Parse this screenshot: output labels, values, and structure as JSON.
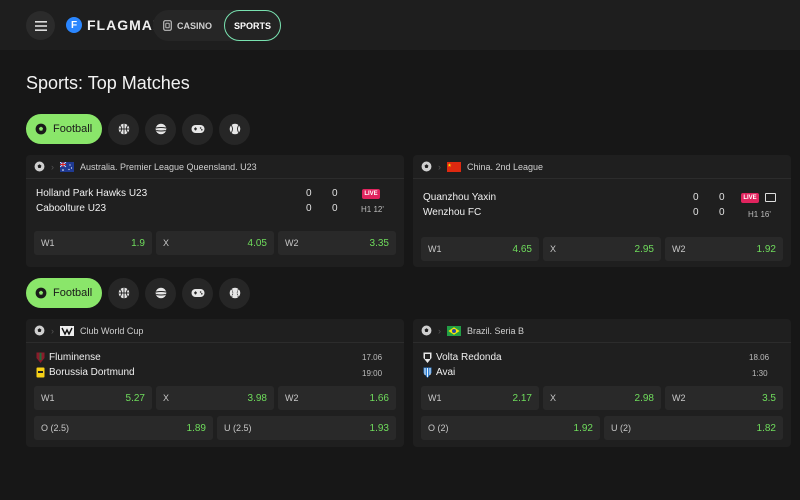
{
  "header": {
    "logo_text": "FLAGMAN",
    "logo_letter": "F",
    "nav": {
      "casino": "CASINO",
      "sports": "SPORTS"
    }
  },
  "page_title": "Sports: Top Matches",
  "filters": [
    {
      "label": "Football",
      "icons": [
        "basketball-icon",
        "volleyball-icon",
        "esports-gamepad-icon",
        "tennis-icon"
      ]
    },
    {
      "label": "Football",
      "icons": [
        "basketball-icon",
        "volleyball-icon",
        "esports-gamepad-icon",
        "baseball-icon"
      ]
    }
  ],
  "cards": [
    {
      "league": "Australia. Premier League Queensland. U23",
      "flag": "australia",
      "team1": "Holland Park Hawks U23",
      "team2": "Caboolture U23",
      "score1": [
        "0",
        "0"
      ],
      "score2": [
        "0",
        "0"
      ],
      "live": "LIVE",
      "time": "H1 12'",
      "odds": [
        {
          "label": "W1",
          "value": "1.9"
        },
        {
          "label": "X",
          "value": "4.05"
        },
        {
          "label": "W2",
          "value": "3.35"
        }
      ]
    },
    {
      "league": "China. 2nd League",
      "flag": "china",
      "team1": "Quanzhou Yaxin",
      "team2": "Wenzhou FC",
      "score1": [
        "0",
        "0"
      ],
      "score2": [
        "0",
        "0"
      ],
      "live": "LIVE",
      "time": "H1 16'",
      "odds": [
        {
          "label": "W1",
          "value": "4.65"
        },
        {
          "label": "X",
          "value": "2.95"
        },
        {
          "label": "W2",
          "value": "1.92"
        }
      ]
    },
    {
      "league": "Club World Cup",
      "flag": "cwc",
      "team1": "Fluminense",
      "team2": "Borussia Dortmund",
      "date": "17.06",
      "kickoff": "19:00",
      "odds": [
        {
          "label": "W1",
          "value": "5.27"
        },
        {
          "label": "X",
          "value": "3.98"
        },
        {
          "label": "W2",
          "value": "1.66"
        }
      ],
      "totals": [
        {
          "label": "O (2.5)",
          "value": "1.89"
        },
        {
          "label": "U (2.5)",
          "value": "1.93"
        }
      ]
    },
    {
      "league": "Brazil. Seria B",
      "flag": "brazil",
      "team1": "Volta Redonda",
      "team2": "Avai",
      "date": "18.06",
      "kickoff": "1:30",
      "odds": [
        {
          "label": "W1",
          "value": "2.17"
        },
        {
          "label": "X",
          "value": "2.98"
        },
        {
          "label": "W2",
          "value": "3.5"
        }
      ],
      "totals": [
        {
          "label": "O (2)",
          "value": "1.92"
        },
        {
          "label": "U (2)",
          "value": "1.82"
        }
      ]
    }
  ],
  "colors": {
    "accent_green": "#8ae66a",
    "odds_green": "#6fdc5c",
    "live_red": "#e0245e",
    "sports_outline": "#79e2b0",
    "logo_blue": "#2a86ff"
  }
}
